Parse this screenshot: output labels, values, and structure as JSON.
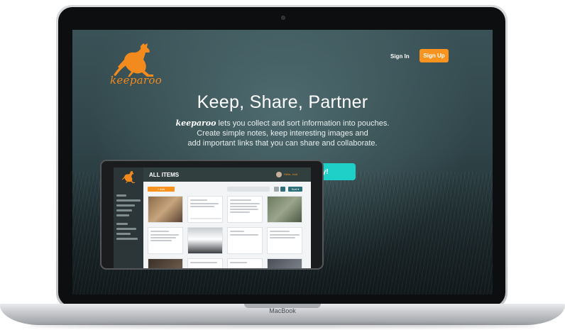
{
  "device": {
    "base_label": "MacBook"
  },
  "nav": {
    "logo_text": "keeparoo",
    "signin_label": "Sign In",
    "signup_label": "Sign Up"
  },
  "hero": {
    "headline": "Keep, Share, Partner",
    "brand_word": "keeparoo",
    "desc_line1": " lets you collect and sort information into pouches.",
    "desc_line2": "Create simple notes, keep interesting images and",
    "desc_line3": "add important links that you can share and collaborate.",
    "cta_label": "Start Your Free Trial Today!"
  },
  "mockup": {
    "title": "ALL ITEMS",
    "add_label": "+ Add",
    "sort_label": "Sort ▾",
    "user_name": "Hello, Jodi"
  },
  "colors": {
    "accent_orange": "#f7931e",
    "cta_teal": "#1fd0c9",
    "screen_bg": "#2f4448"
  },
  "icons": [
    "kangaroo-logo-icon",
    "camera-icon"
  ]
}
